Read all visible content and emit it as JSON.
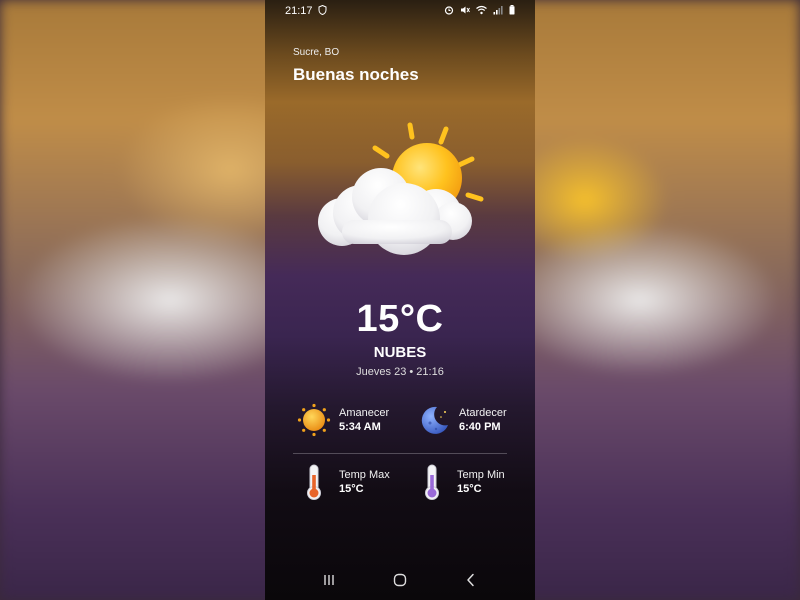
{
  "status_bar": {
    "time": "21:17"
  },
  "location": "Sucre, BO",
  "greeting": "Buenas noches",
  "weather": {
    "temperature": "15°C",
    "condition": "NUBES",
    "date": "Jueves 23 • 21:16",
    "icon": "sun-behind-cloud-icon"
  },
  "details": {
    "sunrise": {
      "label": "Amanecer",
      "value": "5:34 AM",
      "icon": "sun-icon"
    },
    "sunset": {
      "label": "Atardecer",
      "value": "6:40 PM",
      "icon": "moon-icon"
    },
    "temp_max": {
      "label": "Temp Max",
      "value": "15°C",
      "icon": "thermometer-hot-icon"
    },
    "temp_min": {
      "label": "Temp Min",
      "value": "15°C",
      "icon": "thermometer-cold-icon"
    }
  },
  "colors": {
    "sun": "#F9B51C",
    "moon": "#4A6FD8",
    "thermo_hot": "#E8642A",
    "thermo_cold": "#9A6AD8"
  }
}
